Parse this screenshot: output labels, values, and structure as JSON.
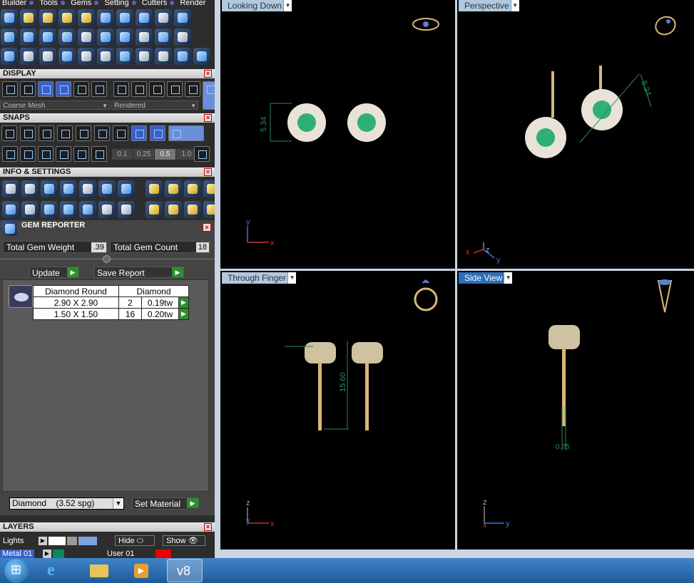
{
  "menubar": {
    "items": [
      "Builder",
      "Tools",
      "Gems",
      "Setting",
      "Cutters",
      "Render"
    ]
  },
  "display": {
    "title": "DISPLAY",
    "mesh_select": "Coarse Mesh",
    "render_select": "Rendered"
  },
  "snaps": {
    "title": "SNAPS",
    "increments": [
      "0.1",
      "0.25",
      "0.5",
      "1.0"
    ],
    "active_increment": "0.5"
  },
  "info": {
    "title": "INFO & SETTINGS"
  },
  "gem_reporter": {
    "title": "GEM REPORTER",
    "total_weight_label": "Total Gem Weight",
    "total_weight_value": ".39",
    "total_count_label": "Total Gem Count",
    "total_count_value": "18",
    "update_label": "Update",
    "save_report_label": "Save Report",
    "table": {
      "headers": [
        "Diamond Round",
        "Diamond"
      ],
      "rows": [
        {
          "size": "2.90 X 2.90",
          "count": "2",
          "weight": "0.19tw"
        },
        {
          "size": "1.50 X 1.50",
          "count": "16",
          "weight": "0.20tw"
        }
      ]
    },
    "material_select": "Diamond    (3.52 spg)",
    "set_material_label": "Set Material"
  },
  "layers": {
    "title": "LAYERS",
    "lights_label": "Lights",
    "hide_label": "Hide",
    "show_label": "Show",
    "metal_label": "Metal 01",
    "user_label": "User 01"
  },
  "viewports": {
    "top_left": {
      "label": "Looking Down",
      "dimension": "5.34",
      "axis_a": "y",
      "axis_b": "x"
    },
    "top_right": {
      "label": "Perspective",
      "dimension": "5.34",
      "axis_a": "x",
      "axis_b": "z",
      "axis_c": "y"
    },
    "bottom_left": {
      "label": "Through Finger",
      "dimension": "15.60",
      "axis_a": "z",
      "axis_b": "y",
      "axis_c": "x"
    },
    "bottom_right": {
      "label": "Side View",
      "dimension": "0.75",
      "axis_a": "z",
      "axis_b": "x",
      "axis_c": "y"
    }
  },
  "taskbar": {
    "app_label": "v8"
  },
  "colors": {
    "gold": "#d9b77a",
    "emerald": "#2fae78",
    "dimension": "#2e8b57",
    "panel": "#2d2d2d"
  }
}
